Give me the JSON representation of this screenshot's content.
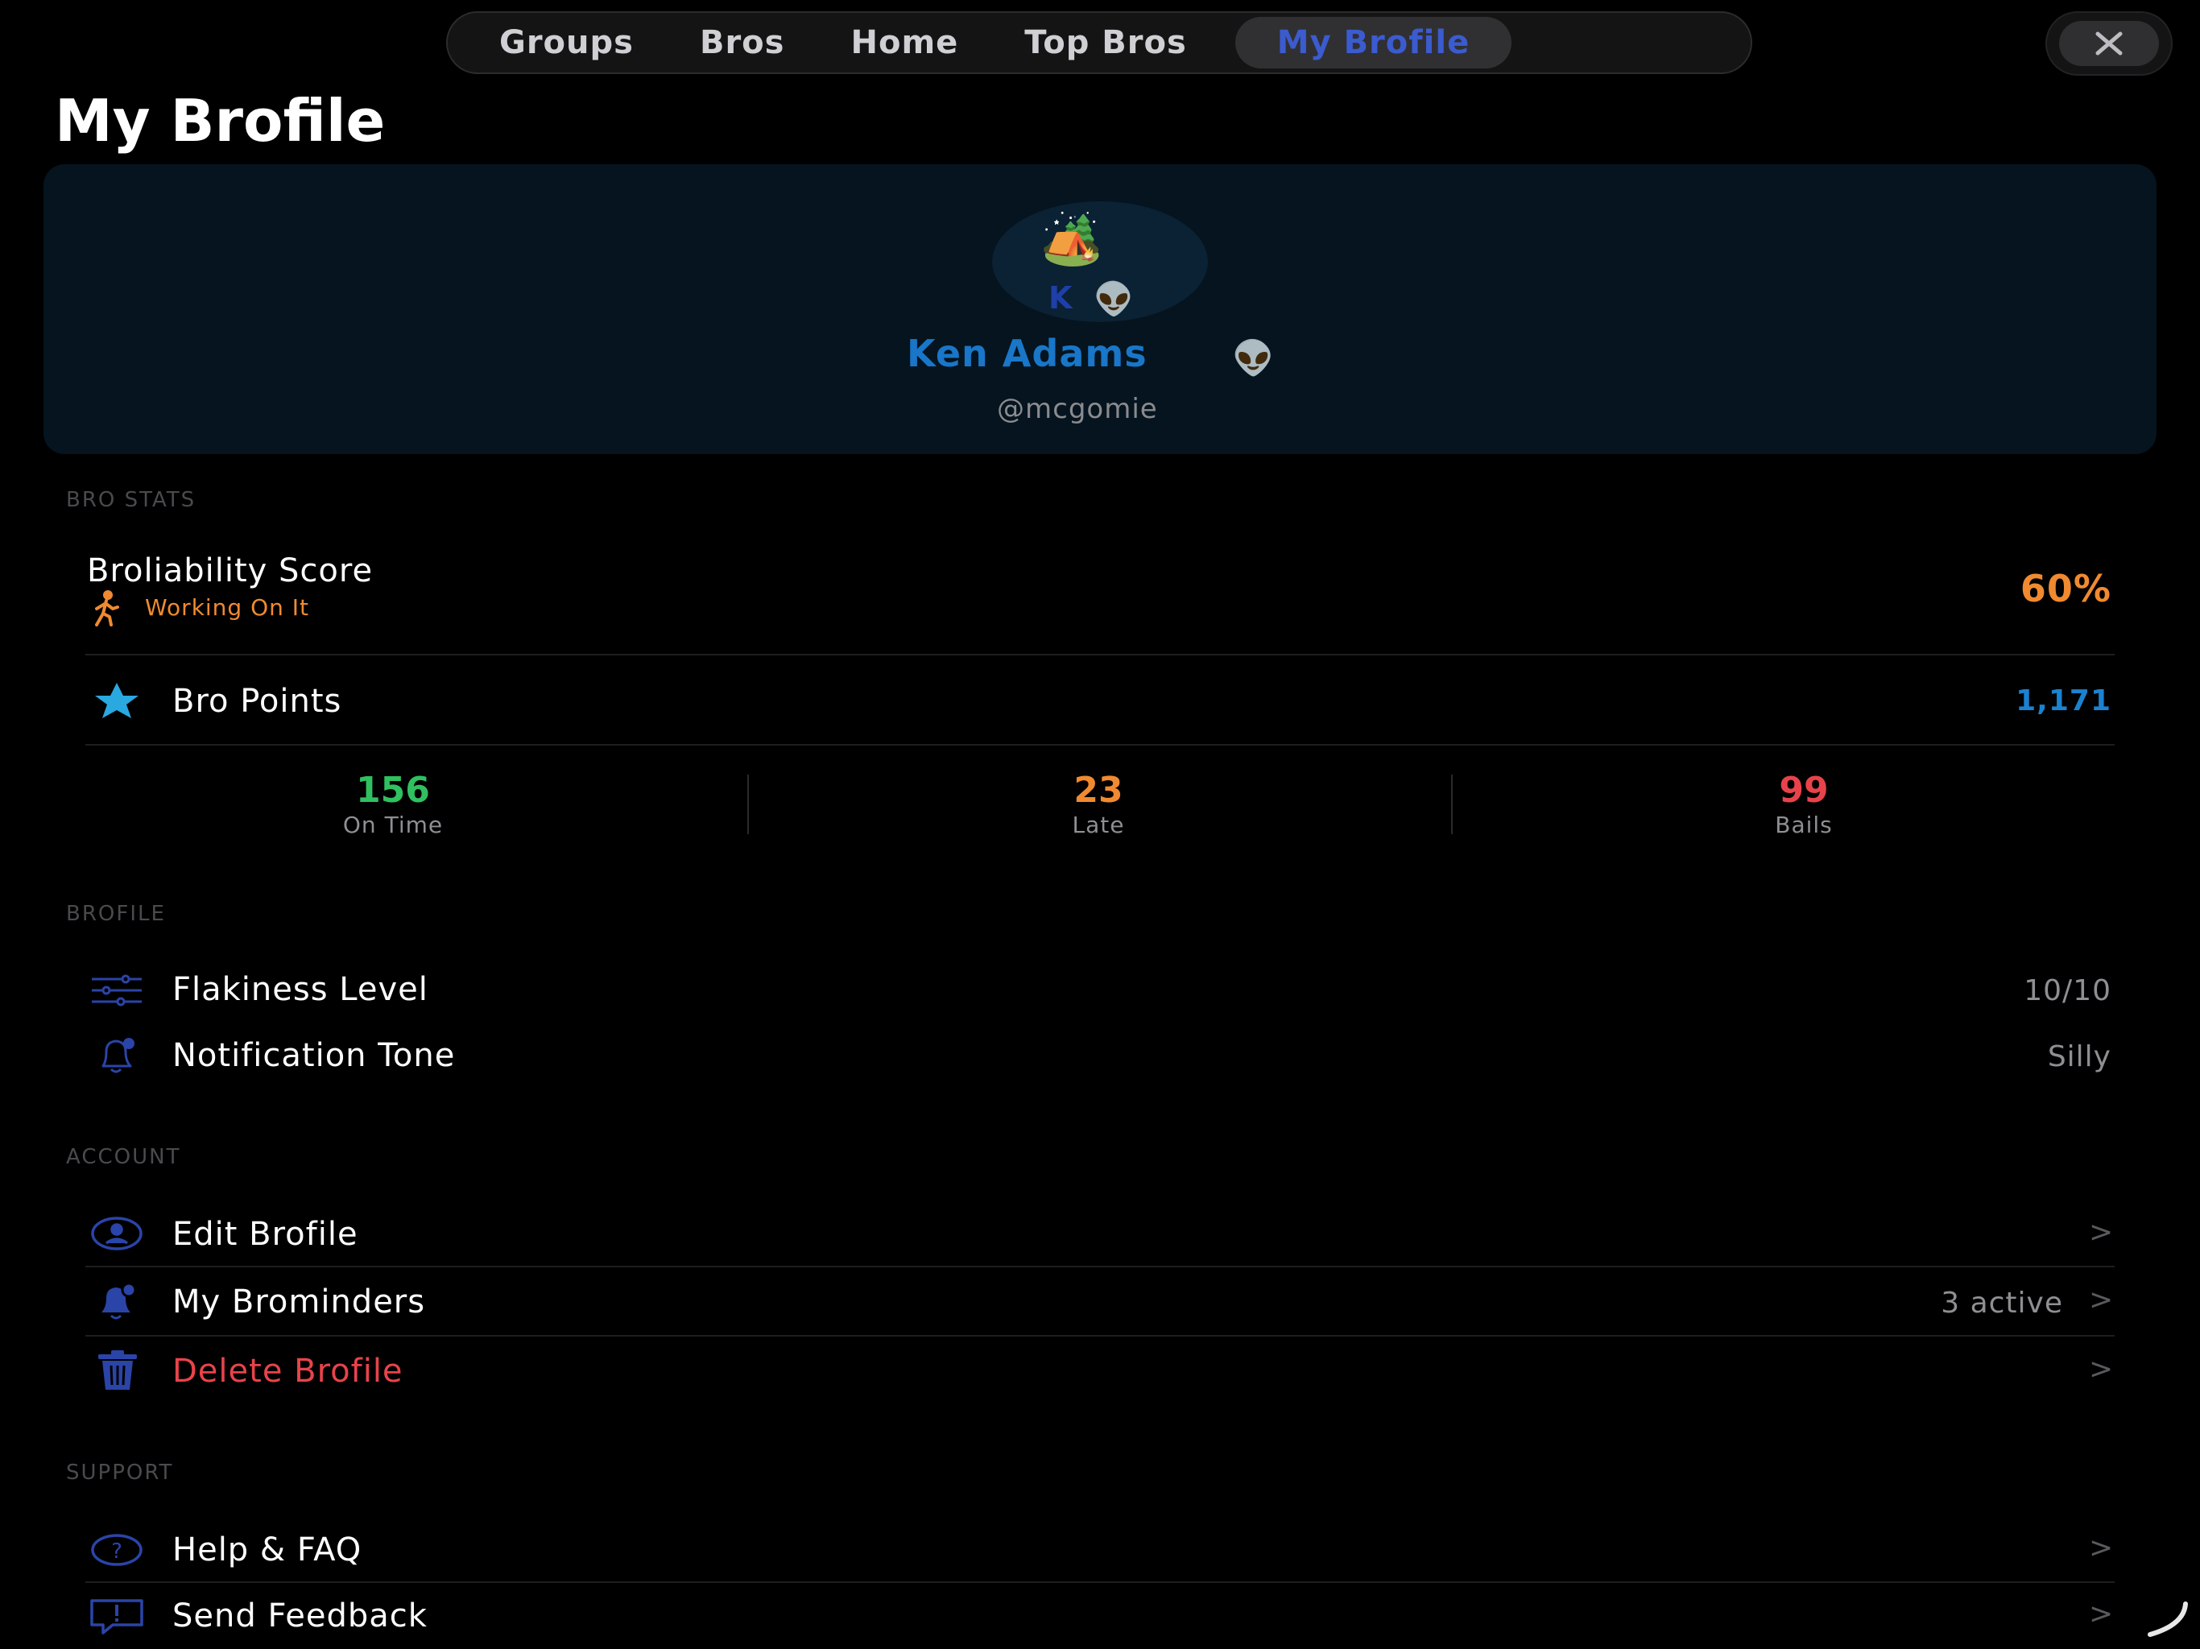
{
  "tabs": [
    {
      "label": "Groups"
    },
    {
      "label": "Bros"
    },
    {
      "label": "Home"
    },
    {
      "label": "Top Bros"
    },
    {
      "label": "My Brofile"
    }
  ],
  "page_title": "My Brofile",
  "profile": {
    "avatar_emoji": "🏕️",
    "avatar_initial": "K",
    "avatar_badge": "👽",
    "name": "Ken Adams",
    "name_emoji": "👽",
    "handle": "@mcgomie"
  },
  "bro_stats": {
    "section_label": "BRO STATS",
    "broliability_label": "Broliability Score",
    "broliability_status": "Working On It",
    "broliability_value": "60%",
    "points_label": "Bro Points",
    "points_value": "1,171",
    "counts": [
      {
        "value": "156",
        "label": "On Time",
        "color": "#30c060"
      },
      {
        "value": "23",
        "label": "Late",
        "color": "#f08a30"
      },
      {
        "value": "99",
        "label": "Bails",
        "color": "#e8434a"
      }
    ]
  },
  "brofile": {
    "section_label": "BROFILE",
    "flakiness_label": "Flakiness Level",
    "flakiness_value": "10/10",
    "tone_label": "Notification Tone",
    "tone_value": "Silly"
  },
  "account": {
    "section_label": "ACCOUNT",
    "edit_label": "Edit Brofile",
    "reminders_label": "My Brominders",
    "reminders_value": "3 active",
    "delete_label": "Delete Brofile",
    "chevron": ">"
  },
  "support": {
    "section_label": "SUPPORT",
    "help_label": "Help & FAQ",
    "feedback_label": "Send Feedback"
  },
  "colors": {
    "accent": "#3b5bcf",
    "name_blue": "#1976c8",
    "orange": "#f08a30",
    "red": "#e8434a",
    "green": "#30c060",
    "icon_blue": "#2a44a8",
    "star": "#2aa8e0"
  }
}
